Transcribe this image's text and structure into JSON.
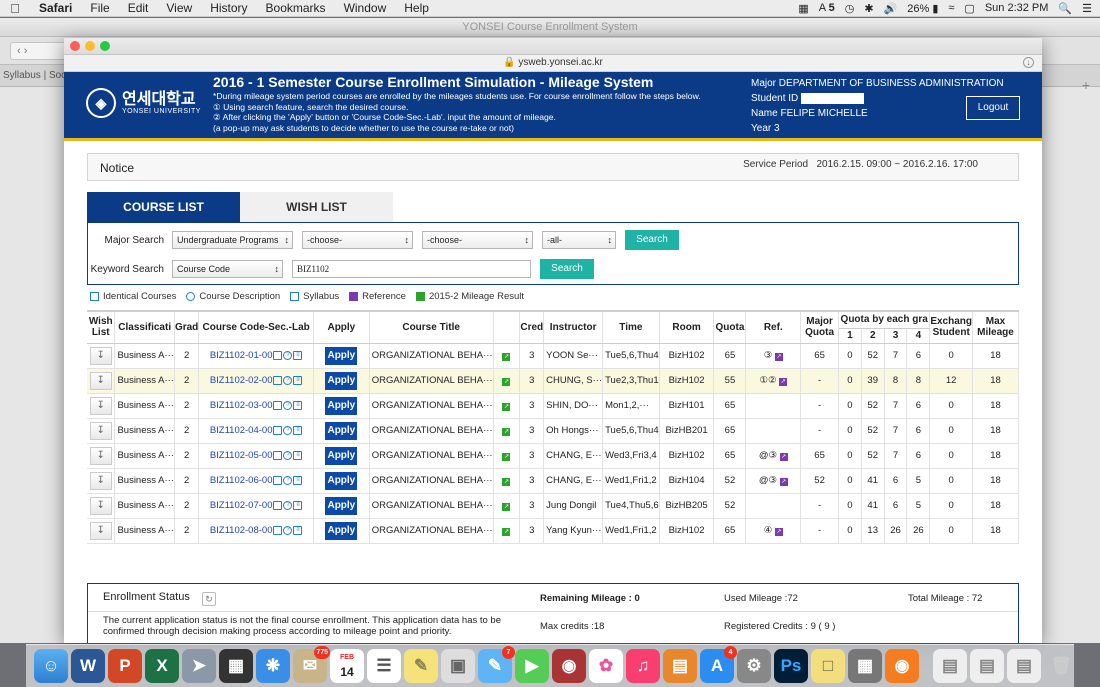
{
  "menubar": {
    "app": "Safari",
    "items": [
      "File",
      "Edit",
      "View",
      "History",
      "Bookmarks",
      "Window",
      "Help"
    ],
    "adobe": "5",
    "battery": "26%",
    "clock": "Sun 2:32 PM"
  },
  "background_window": {
    "title": "YONSEI Course Enrollment System",
    "tab_label": "Syllabus | Socia"
  },
  "browser": {
    "url": "ysweb.yonsei.ac.kr"
  },
  "header": {
    "logo_kr": "연세대학교",
    "logo_en": "YONSEI UNIVERSITY",
    "title": "2016 - 1 Semester Course Enrollment Simulation - Mileage System",
    "notes": [
      "*During mileage system period courses are enrolled by the mileages students use. For course enrollment follow the steps below.",
      "① Using search feature, search the desired course.",
      "② After clicking the 'Apply' button or 'Course Code-Sec.-Lab'. input the amount of mileage.",
      "(a pop-up may ask students to decide whether to use the course re-take or not)"
    ],
    "major_label": "Major",
    "major_value": "DEPARTMENT OF BUSINESS ADMINISTRATION",
    "student_id_label": "Student ID",
    "name_label": "Name",
    "name_value": "FELIPE MICHELLE",
    "year_label": "Year",
    "year_value": "3",
    "logout": "Logout"
  },
  "notice": {
    "title": "Notice",
    "service_period_label": "Service Period",
    "service_period": "2016.2.15. 09:00 ~ 2016.2.16. 17:00"
  },
  "tabs": [
    "COURSE LIST",
    "WISH LIST"
  ],
  "search": {
    "major_label": "Major Search",
    "major_selects": [
      "Undergraduate Programs",
      "-choose-",
      "-choose-",
      "-all-"
    ],
    "keyword_label": "Keyword Search",
    "keyword_select": "Course Code",
    "keyword_value": "BIZ1102",
    "button": "Search"
  },
  "legend": [
    "Identical Courses",
    "Course Description",
    "Syllabus",
    "Reference",
    "2015-2 Mileage Result"
  ],
  "table": {
    "headers": [
      "Wish List",
      "Classificati",
      "Grad",
      "Course Code-Sec.-Lab",
      "Apply",
      "Course Title",
      "",
      "Cred",
      "Instructor",
      "Time",
      "Room",
      "Quota",
      "Ref.",
      "Major Quota",
      "Quota by each gra",
      "Exchang Student",
      "Max Mileage"
    ],
    "quota_sub": [
      "1",
      "2",
      "3",
      "4"
    ],
    "apply_label": "Apply",
    "rows": [
      {
        "cls": "Business A···",
        "grade": "2",
        "code": "BIZ1102-01-00",
        "title": "ORGANIZATIONAL BEHA···",
        "credit": "3",
        "instructor": "YOON Se···",
        "time": "Tue5,6,Thu4",
        "room": "BizH102",
        "quota": "65",
        "ref": "③",
        "major_quota": "65",
        "q1": "0",
        "q2": "52",
        "q3": "7",
        "q4": "6",
        "exchange": "0",
        "max": "18"
      },
      {
        "cls": "Business A···",
        "grade": "2",
        "code": "BIZ1102-02-00",
        "title": "ORGANIZATIONAL BEHA···",
        "credit": "3",
        "instructor": "CHUNG, S···",
        "time": "Tue2,3,Thu1",
        "room": "BizH102",
        "quota": "55",
        "ref": "①②",
        "major_quota": "-",
        "q1": "0",
        "q2": "39",
        "q3": "8",
        "q4": "8",
        "exchange": "12",
        "max": "18"
      },
      {
        "cls": "Business A···",
        "grade": "2",
        "code": "BIZ1102-03-00",
        "title": "ORGANIZATIONAL BEHA···",
        "credit": "3",
        "instructor": "SHIN, DO···",
        "time": "Mon1,2,···",
        "room": "BizH101",
        "quota": "65",
        "ref": "",
        "major_quota": "-",
        "q1": "0",
        "q2": "52",
        "q3": "7",
        "q4": "6",
        "exchange": "0",
        "max": "18"
      },
      {
        "cls": "Business A···",
        "grade": "2",
        "code": "BIZ1102-04-00",
        "title": "ORGANIZATIONAL BEHA···",
        "credit": "3",
        "instructor": "Oh Hongs···",
        "time": "Tue5,6,Thu4",
        "room": "BizHB201",
        "quota": "65",
        "ref": "",
        "major_quota": "-",
        "q1": "0",
        "q2": "52",
        "q3": "7",
        "q4": "6",
        "exchange": "0",
        "max": "18"
      },
      {
        "cls": "Business A···",
        "grade": "2",
        "code": "BIZ1102-05-00",
        "title": "ORGANIZATIONAL BEHA···",
        "credit": "3",
        "instructor": "CHANG, E···",
        "time": "Wed3,Fri3,4",
        "room": "BizH102",
        "quota": "65",
        "ref": "@③",
        "major_quota": "65",
        "q1": "0",
        "q2": "52",
        "q3": "7",
        "q4": "6",
        "exchange": "0",
        "max": "18"
      },
      {
        "cls": "Business A···",
        "grade": "2",
        "code": "BIZ1102-06-00",
        "title": "ORGANIZATIONAL BEHA···",
        "credit": "3",
        "instructor": "CHANG, E···",
        "time": "Wed1,Fri1,2",
        "room": "BizH104",
        "quota": "52",
        "ref": "@③",
        "major_quota": "52",
        "q1": "0",
        "q2": "41",
        "q3": "6",
        "q4": "5",
        "exchange": "0",
        "max": "18"
      },
      {
        "cls": "Business A···",
        "grade": "2",
        "code": "BIZ1102-07-00",
        "title": "ORGANIZATIONAL BEHA···",
        "credit": "3",
        "instructor": "Jung Dongil",
        "time": "Tue4,Thu5,6",
        "room": "BizHB205",
        "quota": "52",
        "ref": "",
        "major_quota": "-",
        "q1": "0",
        "q2": "41",
        "q3": "6",
        "q4": "5",
        "exchange": "0",
        "max": "18"
      },
      {
        "cls": "Business A···",
        "grade": "2",
        "code": "BIZ1102-08-00",
        "title": "ORGANIZATIONAL BEHA···",
        "credit": "3",
        "instructor": "Yang Kyun···",
        "time": "Wed1,Fri1,2",
        "room": "BizH102",
        "quota": "65",
        "ref": "④",
        "major_quota": "-",
        "q1": "0",
        "q2": "13",
        "q3": "26",
        "q4": "26",
        "exchange": "0",
        "max": "18"
      }
    ]
  },
  "enrollment": {
    "title": "Enrollment Status",
    "remaining_mileage": "Remaining Mileage : 0",
    "used_mileage": "Used Mileage :72",
    "total_mileage": "Total Mileage : 72",
    "message": "The current application status is not the final course enrollment. This application data has to be confirmed through decision making process according to mileage point and priority.",
    "max_credits": "Max credits :18",
    "registered_credits": "Registered Credits : 9 ( 9 )"
  },
  "dock": {
    "badges": {
      "mail": "775",
      "calendar_month": "FEB",
      "calendar_day": "14",
      "messages": "7",
      "appstore": "4"
    }
  }
}
